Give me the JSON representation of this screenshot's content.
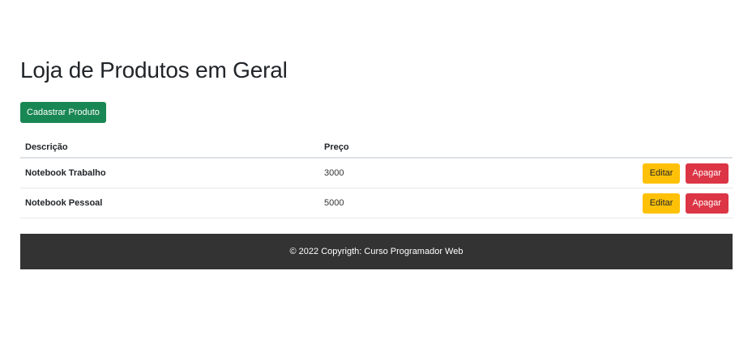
{
  "page": {
    "title": "Loja de Produtos em Geral"
  },
  "toolbar": {
    "add_label": "Cadastrar Produto"
  },
  "table": {
    "headers": {
      "description": "Descrição",
      "price": "Preço"
    },
    "rows": [
      {
        "name": "Notebook Trabalho",
        "price": "3000",
        "edit_label": "Editar",
        "delete_label": "Apagar"
      },
      {
        "name": "Notebook Pessoal",
        "price": "5000",
        "edit_label": "Editar",
        "delete_label": "Apagar"
      }
    ]
  },
  "footer": {
    "text": "© 2022 Copyrigth: Curso Programador Web"
  },
  "colors": {
    "primary_add": "#198754",
    "edit": "#ffc107",
    "delete": "#dc3545",
    "footer_bg": "#333333"
  }
}
